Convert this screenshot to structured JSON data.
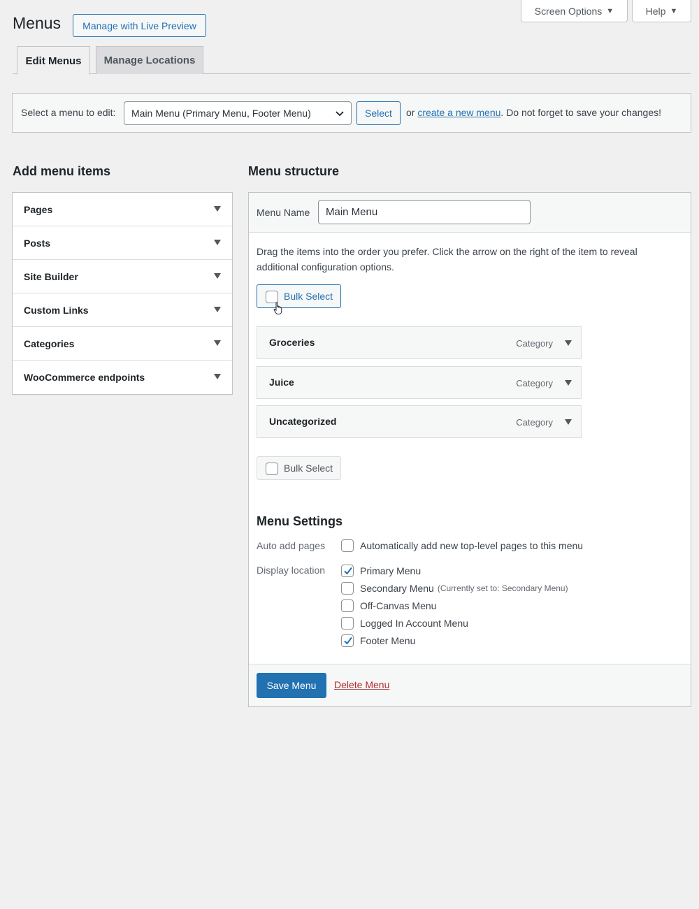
{
  "header": {
    "title": "Menus",
    "live_preview": "Manage with Live Preview",
    "screen_options": "Screen Options",
    "help": "Help"
  },
  "tabs": [
    {
      "label": "Edit Menus",
      "active": true
    },
    {
      "label": "Manage Locations",
      "active": false
    }
  ],
  "select_bar": {
    "label": "Select a menu to edit:",
    "selected_menu": "Main Menu (Primary Menu, Footer Menu)",
    "select_button": "Select",
    "or_text": "or",
    "create_link": "create a new menu",
    "trailing_text": ". Do not forget to save your changes!"
  },
  "add_items": {
    "heading": "Add menu items",
    "sections": [
      "Pages",
      "Posts",
      "Site Builder",
      "Custom Links",
      "Categories",
      "WooCommerce endpoints"
    ]
  },
  "structure": {
    "heading": "Menu structure",
    "menu_name_label": "Menu Name",
    "menu_name_value": "Main Menu",
    "instructions": "Drag the items into the order you prefer. Click the arrow on the right of the item to reveal additional configuration options.",
    "bulk_select": "Bulk Select",
    "items": [
      {
        "title": "Groceries",
        "type": "Category"
      },
      {
        "title": "Juice",
        "type": "Category"
      },
      {
        "title": "Uncategorized",
        "type": "Category"
      }
    ]
  },
  "settings": {
    "heading": "Menu Settings",
    "auto_add_label": "Auto add pages",
    "auto_add_option": "Automatically add new top-level pages to this menu",
    "auto_add_checked": false,
    "display_location_label": "Display location",
    "locations": [
      {
        "label": "Primary Menu",
        "note": "",
        "checked": true
      },
      {
        "label": "Secondary Menu",
        "note": "(Currently set to: Secondary Menu)",
        "checked": false
      },
      {
        "label": "Off-Canvas Menu",
        "note": "",
        "checked": false
      },
      {
        "label": "Logged In Account Menu",
        "note": "",
        "checked": false
      },
      {
        "label": "Footer Menu",
        "note": "",
        "checked": true
      }
    ]
  },
  "footer": {
    "save": "Save Menu",
    "delete": "Delete Menu"
  },
  "colors": {
    "accent": "#2271b1",
    "danger": "#b32d2e",
    "background": "#f0f0f1"
  }
}
